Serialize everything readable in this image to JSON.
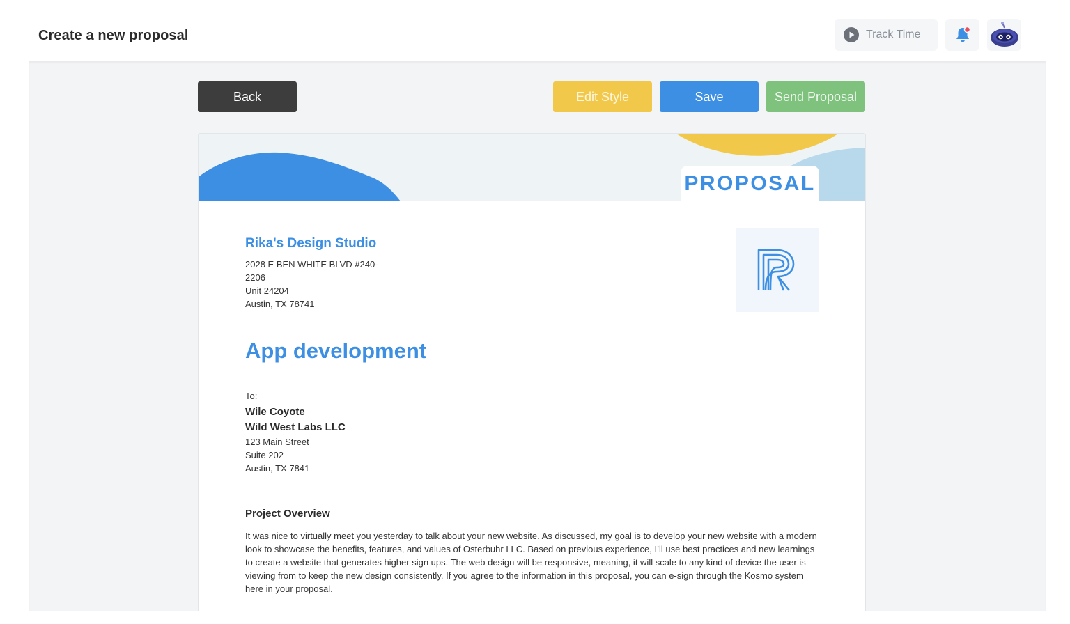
{
  "header": {
    "title": "Create a new proposal",
    "track_time_label": "Track Time",
    "icons": [
      "play-icon",
      "bell-icon",
      "robot-avatar-icon"
    ]
  },
  "toolbar": {
    "back_label": "Back",
    "edit_style_label": "Edit Style",
    "save_label": "Save",
    "send_label": "Send Proposal"
  },
  "colors": {
    "primary_blue": "#3c8fe3",
    "yellow": "#f2c84b",
    "green": "#7ec27e",
    "dark": "#3d3d3d",
    "notification_dot": "#e94b5b"
  },
  "proposal": {
    "banner_label": "PROPOSAL",
    "studio": {
      "name": "Rika's Design Studio",
      "address_lines": [
        "2028 E BEN WHITE BLVD #240-",
        "2206",
        "Unit 24204",
        "Austin, TX 78741"
      ]
    },
    "title": "App development",
    "recipient": {
      "to_label": "To:",
      "name": "Wile Coyote",
      "company": "Wild West Labs LLC",
      "address_lines": [
        "123 Main Street",
        "Suite 202",
        "Austin, TX 7841"
      ]
    },
    "overview": {
      "heading": "Project Overview",
      "body": "It was nice to virtually meet you yesterday to talk about your new website. As discussed, my goal is to develop your new website with a modern look to showcase the benefits, features, and values of Osterbuhr LLC. Based on previous experience, I’ll use best practices and new learnings to create a website that generates higher sign ups. The web design will be responsive, meaning, it will scale to any kind of device the user is viewing from to keep the new design consistently. If you agree to the information in this proposal, you can e-sign through the Kosmo system here in your proposal."
    }
  }
}
